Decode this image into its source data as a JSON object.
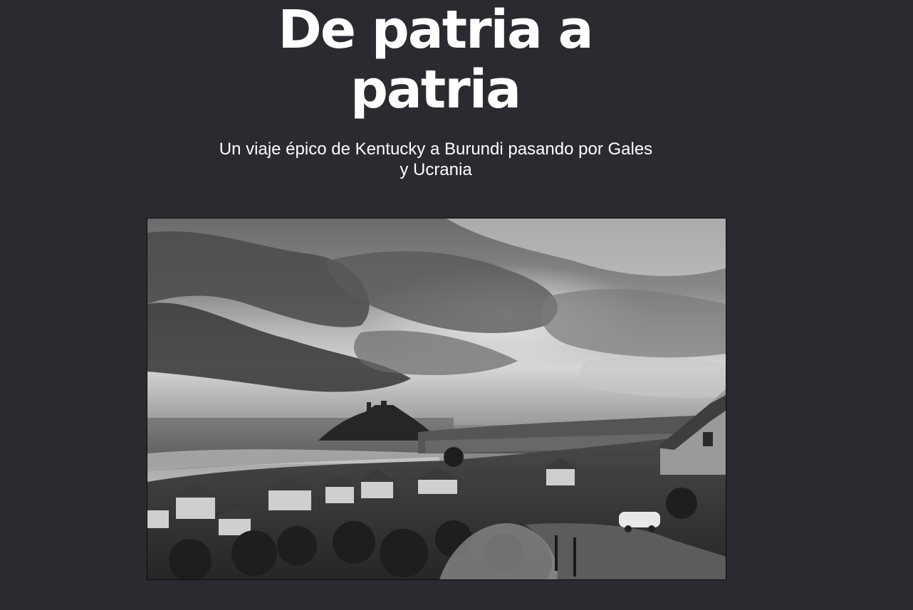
{
  "header": {
    "title": "De patria a patria",
    "subtitle": "Un viaje épico de Kentucky a Burundi pasando por Gales y Ucrania"
  },
  "hero_image": {
    "style": "black-and-white photograph",
    "icon": "landscape-photo-icon"
  },
  "colors": {
    "background": "#2a2b30",
    "text": "#ffffff"
  }
}
